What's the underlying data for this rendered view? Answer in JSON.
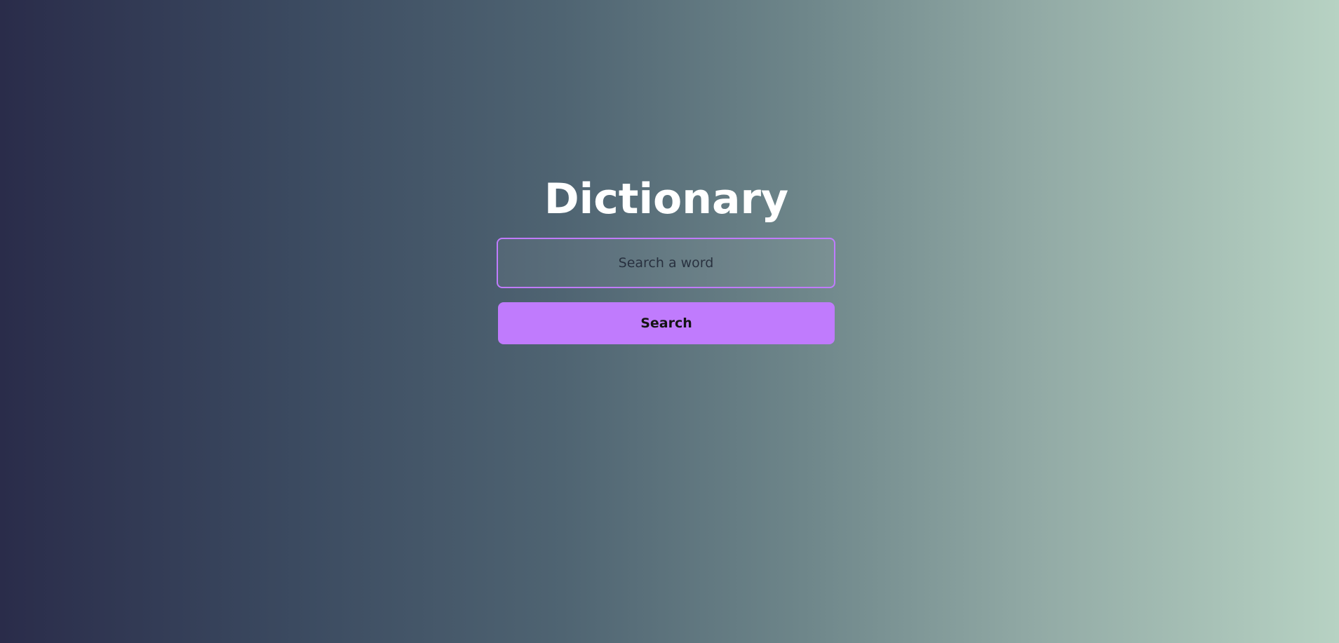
{
  "app": {
    "title": "Dictionary"
  },
  "search": {
    "value": "",
    "placeholder": "Search a word",
    "button_label": "Search"
  },
  "colors": {
    "accent": "#c07bfd",
    "background_start": "#2a2c4a",
    "background_end": "#b7d2c3",
    "title_text": "#ffffff"
  }
}
